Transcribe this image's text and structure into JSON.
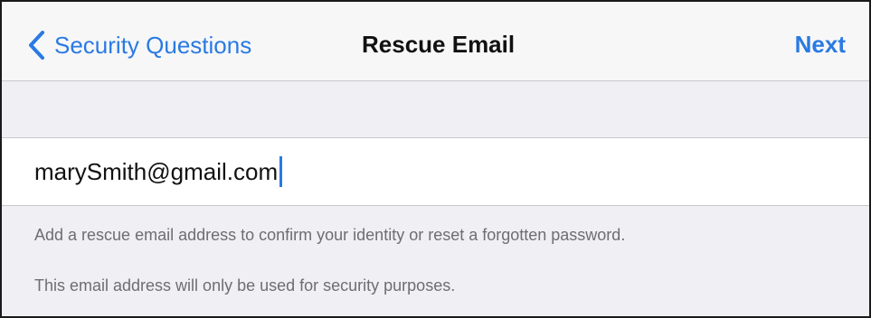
{
  "navbar": {
    "back_label": "Security Questions",
    "back_icon": "chevron-left-icon",
    "title": "Rescue Email",
    "next_label": "Next"
  },
  "email_field": {
    "value": "marySmith@gmail.com"
  },
  "footer": {
    "line1": "Add a rescue email address to confirm your identity or reset a forgotten password.",
    "line2": "This email address will only be used for security purposes."
  },
  "colors": {
    "accent": "#2a7ae2",
    "background": "#efeff4",
    "secondary_text": "#6d6d72"
  }
}
